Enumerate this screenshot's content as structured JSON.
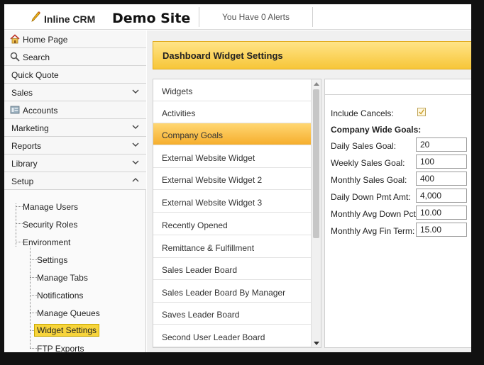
{
  "header": {
    "app_name": "Inline CRM",
    "site_title": "Demo Site",
    "alerts_text": "You Have 0 Alerts"
  },
  "sidebar": {
    "nav": [
      {
        "label": "Home Page",
        "icon": "home-icon"
      },
      {
        "label": "Search",
        "icon": "search-icon"
      },
      {
        "label": "Quick Quote"
      },
      {
        "label": "Sales",
        "chevron": "down"
      },
      {
        "label": "Accounts",
        "icon": "accounts-icon"
      },
      {
        "label": "Marketing",
        "chevron": "down"
      },
      {
        "label": "Reports",
        "chevron": "down"
      },
      {
        "label": "Library",
        "chevron": "down"
      },
      {
        "label": "Setup",
        "chevron": "up"
      }
    ],
    "tree": {
      "manage_users": "Manage Users",
      "security_roles": "Security Roles",
      "environment": "Environment",
      "settings": "Settings",
      "manage_tabs": "Manage Tabs",
      "notifications": "Notifications",
      "manage_queues": "Manage Queues",
      "widget_settings": "Widget Settings",
      "ftp_exports": "FTP Exports"
    }
  },
  "main": {
    "title": "Dashboard Widget Settings",
    "widgets_header": "Widgets",
    "widgets": [
      "Activities",
      "Company Goals",
      "External Website Widget",
      "External Website Widget 2",
      "External Website Widget 3",
      "Recently Opened",
      "Remittance & Fulfillment",
      "Sales Leader Board",
      "Sales Leader Board By Manager",
      "Saves Leader Board",
      "Second User Leader Board"
    ],
    "selected_widget": "Company Goals",
    "settings": {
      "include_cancels_label": "Include Cancels:",
      "include_cancels_checked": true,
      "company_wide_goals": "Company Wide Goals:",
      "fields": [
        {
          "label": "Daily Sales Goal:",
          "value": "20"
        },
        {
          "label": "Weekly Sales Goal:",
          "value": "100"
        },
        {
          "label": "Monthly Sales Goal:",
          "value": "400"
        },
        {
          "label": "Daily Down Pmt Amt:",
          "value": "4,000"
        },
        {
          "label": "Monthly Avg Down Pct:",
          "value": "10.00"
        },
        {
          "label": "Monthly Avg Fin Term:",
          "value": "15.00"
        }
      ]
    }
  },
  "colors": {
    "accent": "#f7c638",
    "selected_item": "#f6ae2d",
    "checkbox_mark": "#c99a1e"
  }
}
